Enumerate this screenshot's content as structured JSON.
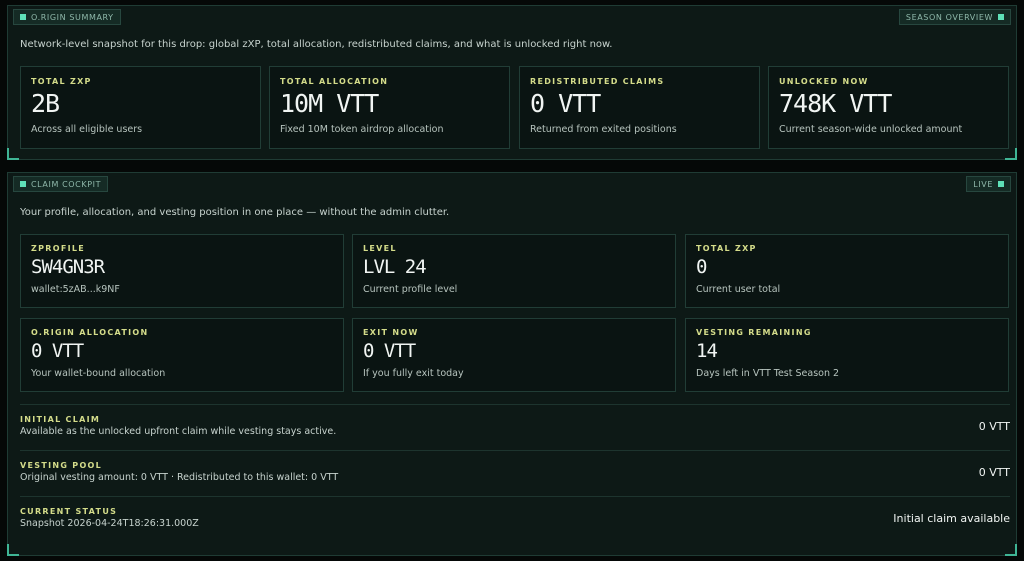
{
  "summary": {
    "tag_left": "O.RIGIN SUMMARY",
    "tag_right": "SEASON OVERVIEW",
    "description": "Network-level snapshot for this drop: global zXP, total allocation, redistributed claims, and what is unlocked right now.",
    "cards": [
      {
        "label": "TOTAL ZXP",
        "value": "2B",
        "sub": "Across all eligible users"
      },
      {
        "label": "TOTAL ALLOCATION",
        "value": "10M VTT",
        "sub": "Fixed 10M token airdrop allocation"
      },
      {
        "label": "REDISTRIBUTED CLAIMS",
        "value": "0 VTT",
        "sub": "Returned from exited positions"
      },
      {
        "label": "UNLOCKED NOW",
        "value": "748K VTT",
        "sub": "Current season-wide unlocked amount"
      }
    ]
  },
  "cockpit": {
    "tag_left": "CLAIM COCKPIT",
    "tag_right": "LIVE",
    "description": "Your profile, allocation, and vesting position in one place — without the admin clutter.",
    "cards": [
      {
        "label": "ZPROFILE",
        "value": "SW4GN3R",
        "sub": "wallet:5zAB...k9NF"
      },
      {
        "label": "LEVEL",
        "value": "LVL 24",
        "sub": "Current profile level"
      },
      {
        "label": "TOTAL ZXP",
        "value": "0",
        "sub": "Current user total"
      },
      {
        "label": "O.RIGIN ALLOCATION",
        "value": "0 VTT",
        "sub": "Your wallet-bound allocation"
      },
      {
        "label": "EXIT NOW",
        "value": "0 VTT",
        "sub": "If you fully exit today"
      },
      {
        "label": "VESTING REMAINING",
        "value": "14",
        "sub": "Days left in VTT Test Season 2"
      }
    ],
    "rows": [
      {
        "label": "INITIAL CLAIM",
        "sub": "Available as the unlocked upfront claim while vesting stays active.",
        "value": "0 VTT"
      },
      {
        "label": "VESTING POOL",
        "sub": "Original vesting amount: 0 VTT · Redistributed to this wallet: 0 VTT",
        "value": "0 VTT"
      },
      {
        "label": "CURRENT STATUS",
        "sub": "Snapshot 2026-04-24T18:26:31.000Z",
        "value": "Initial claim available"
      }
    ]
  },
  "colors": {
    "accent": "#5fe0b8",
    "label": "#d4dc8a",
    "panel_bg": "#0d1916"
  }
}
